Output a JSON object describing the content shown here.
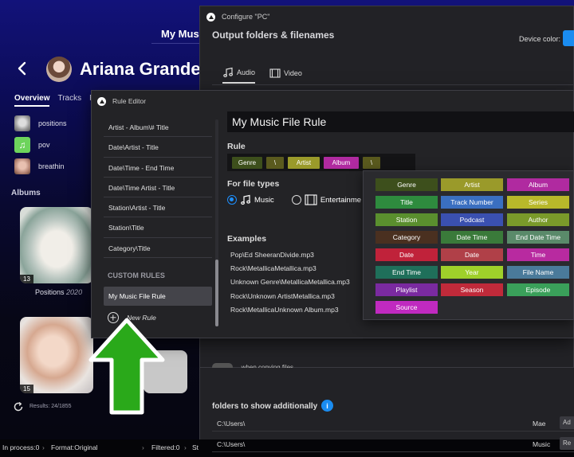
{
  "background_app": {
    "title": "My Musi",
    "artist_name": "Ariana Grande",
    "tabs": [
      {
        "label": "Overview",
        "active": true
      },
      {
        "label": "Tracks",
        "active": false
      },
      {
        "label": "Pl",
        "active": false
      }
    ],
    "tracks": [
      {
        "title": "positions"
      },
      {
        "title": "pov"
      },
      {
        "title": "breathin"
      }
    ],
    "albums_label": "Albums",
    "albums": [
      {
        "badge": "13",
        "title": "Positions",
        "year": "2020"
      },
      {
        "badge": "15"
      }
    ],
    "results_text": "Results: 24/1855",
    "status_bar": {
      "in_process": "In process:0",
      "format": "Format:Original",
      "filtered": "Filtered:0",
      "st": "St"
    }
  },
  "configure_window": {
    "title": "Configure \"PC\"",
    "heading": "Output folders & filenames",
    "device_color_label": "Device color:",
    "device_color": "#1a8cf0",
    "tabs": [
      {
        "label": "Audio",
        "icon": "music-note-icon",
        "active": true
      },
      {
        "label": "Video",
        "icon": "film-icon",
        "active": false
      }
    ],
    "copying_text": "...when copying files",
    "folders_label": "folders to show additionally",
    "folders": [
      {
        "path": "C:\\Users\\",
        "name": "Mae",
        "button": "Ad"
      },
      {
        "path": "C:\\Users\\",
        "name": "Music",
        "button": "Re"
      }
    ]
  },
  "rule_editor": {
    "title": "Rule Editor",
    "preset_rules": [
      "Artist - Album\\# Title",
      "Date\\Artist - Title",
      "Date\\Time - End Time",
      "Date\\Time Artist - Title",
      "Station\\Artist - Title",
      "Station\\Title",
      "Category\\Title"
    ],
    "custom_rules_header": "CUSTOM RULES",
    "custom_rules": [
      "My Music File Rule"
    ],
    "new_rule_label": "New Rule",
    "rule_name": "My Music File Rule",
    "rule_label": "Rule",
    "rule_chips": [
      {
        "label": "Genre",
        "color": "#3d4f1c"
      },
      {
        "label": "\\",
        "color": "#5a5a1e"
      },
      {
        "label": "Artist",
        "color": "#9a9a2a"
      },
      {
        "label": "Album",
        "color": "#b02aa0"
      },
      {
        "label": "\\",
        "color": "#5a5a1e"
      }
    ],
    "file_types_label": "For file types",
    "file_types": [
      {
        "label": "Music",
        "icon": "music-note-icon",
        "checked": true
      },
      {
        "label": "Entertainme",
        "icon": "film-icon",
        "checked": false
      }
    ],
    "examples_label": "Examples",
    "examples": [
      "Pop\\Ed SheeranDivide.mp3",
      "Rock\\MetallicaMetallica.mp3",
      "Unknown Genre\\MetallicaMetallica.mp3",
      "Rock\\Unknown ArtistMetallica.mp3",
      "Rock\\MetallicaUnknown Album.mp3"
    ]
  },
  "tag_palette": [
    {
      "label": "Genre",
      "color": "#3d4f1c"
    },
    {
      "label": "Artist",
      "color": "#9a9a2a"
    },
    {
      "label": "Album",
      "color": "#b02aa0"
    },
    {
      "label": "Title",
      "color": "#2e8b3e"
    },
    {
      "label": "Track Number",
      "color": "#3a6fc0"
    },
    {
      "label": "Series",
      "color": "#b8b82a"
    },
    {
      "label": "Station",
      "color": "#5a8f2e"
    },
    {
      "label": "Podcast",
      "color": "#3a50b0"
    },
    {
      "label": "Author",
      "color": "#7a9a2a"
    },
    {
      "label": "Category",
      "color": "#4a3020"
    },
    {
      "label": "Date Time",
      "color": "#3a7a3a"
    },
    {
      "label": "End Date Time",
      "color": "#5a8a6a"
    },
    {
      "label": "Date",
      "color": "#c0223a"
    },
    {
      "label": "Date",
      "color": "#b04048"
    },
    {
      "label": "Time",
      "color": "#b82aa0"
    },
    {
      "label": "End Time",
      "color": "#1f6f5a"
    },
    {
      "label": "Year",
      "color": "#9fd02a"
    },
    {
      "label": "File Name",
      "color": "#4a7a9a"
    },
    {
      "label": "Playlist",
      "color": "#7a2aa0"
    },
    {
      "label": "Season",
      "color": "#c02a3a"
    },
    {
      "label": "Episode",
      "color": "#3aa05a"
    },
    {
      "label": "Source",
      "color": "#c02ac0"
    }
  ],
  "annotation_arrow_color": "#2aa91a"
}
